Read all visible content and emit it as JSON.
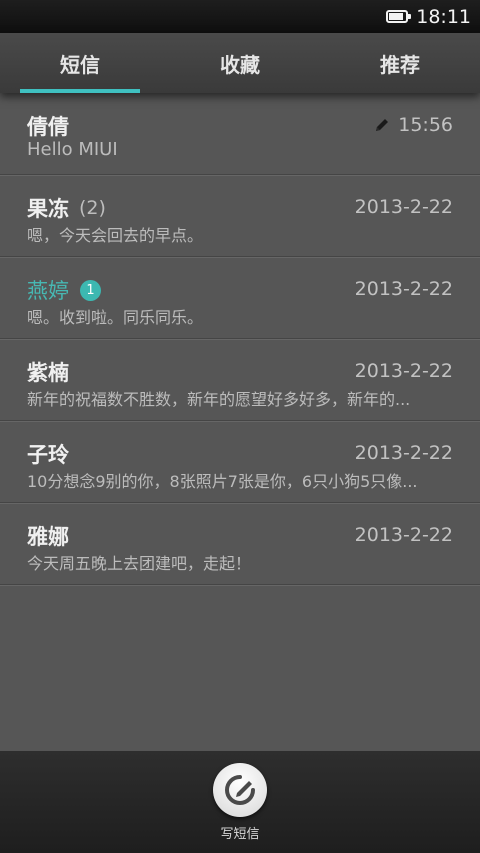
{
  "status_bar": {
    "time": "18:11",
    "battery_level": 0.85
  },
  "tabs": [
    {
      "label": "短信",
      "active": true
    },
    {
      "label": "收藏",
      "active": false
    },
    {
      "label": "推荐",
      "active": false
    }
  ],
  "conversations": [
    {
      "name": "倩倩",
      "count": "",
      "badge": "",
      "time": "15:56",
      "draft": true,
      "preview": "Hello MIUI",
      "unread": false
    },
    {
      "name": "果冻",
      "count": "(2)",
      "badge": "",
      "time": "2013-2-22",
      "draft": false,
      "preview": "嗯，今天会回去的早点。",
      "unread": false
    },
    {
      "name": "燕婷",
      "count": "",
      "badge": "1",
      "time": "2013-2-22",
      "draft": false,
      "preview": "嗯。收到啦。同乐同乐。",
      "unread": true
    },
    {
      "name": "紫楠",
      "count": "",
      "badge": "",
      "time": "2013-2-22",
      "draft": false,
      "preview": "新年的祝福数不胜数，新年的愿望好多好多，新年的...",
      "unread": false
    },
    {
      "name": "子玲",
      "count": "",
      "badge": "",
      "time": "2013-2-22",
      "draft": false,
      "preview": "10分想念9别的你，8张照片7张是你，6只小狗5只像...",
      "unread": false
    },
    {
      "name": "雅娜",
      "count": "",
      "badge": "",
      "time": "2013-2-22",
      "draft": false,
      "preview": "今天周五晚上去团建吧，走起！",
      "unread": false
    }
  ],
  "bottom_bar": {
    "compose_label": "写短信",
    "compose_icon": "compose-icon"
  },
  "colors": {
    "accent": "#3fc0c0",
    "unread_name": "#47b8b3",
    "background": "#565656"
  }
}
